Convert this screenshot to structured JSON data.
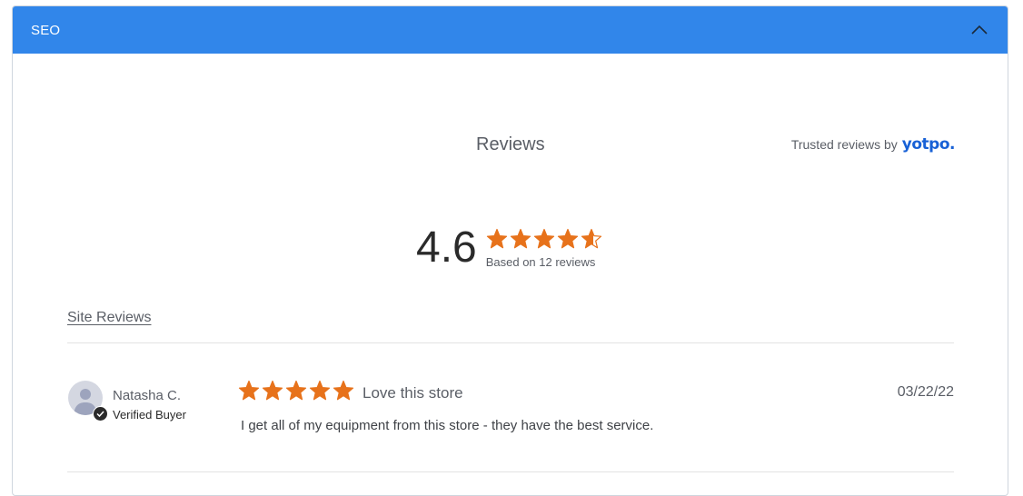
{
  "panel": {
    "title": "SEO",
    "header_color": "#3186ea",
    "collapse_icon": "chevron-up-icon"
  },
  "reviews_widget": {
    "heading": "Reviews",
    "trusted_prefix": "Trusted reviews by",
    "brand": "yotpo.",
    "average_rating": "4.6",
    "average_rating_value": 4.6,
    "star_color": "#e7721b",
    "based_on": "Based on 12 reviews",
    "tab_label": "Site Reviews"
  },
  "reviews": [
    {
      "reviewer": "Natasha C.",
      "badge": "Verified Buyer",
      "rating": 5,
      "title": "Love this store",
      "date": "03/22/22",
      "body": "I get all of my equipment from this store - they have the best service."
    }
  ]
}
